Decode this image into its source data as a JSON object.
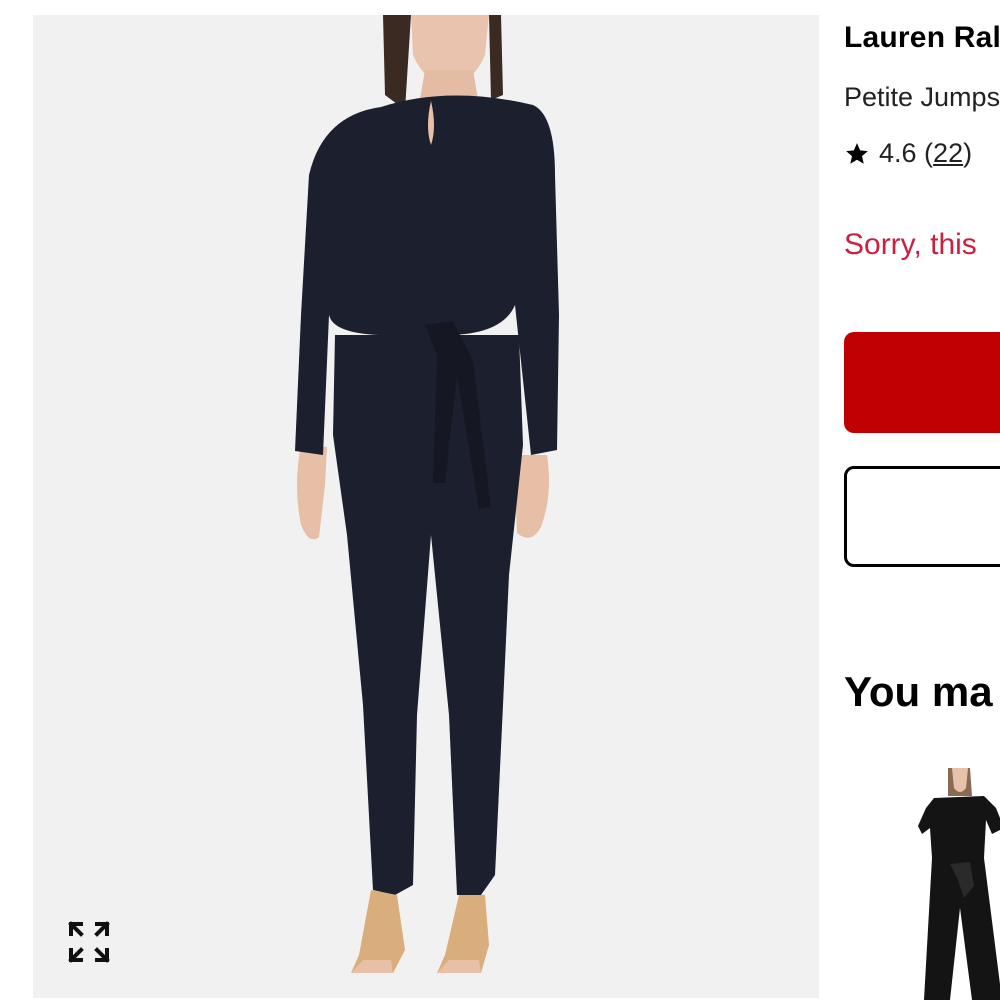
{
  "product": {
    "brand": "Lauren Ral",
    "name": "Petite Jumps",
    "rating": "4.6",
    "review_count": "22",
    "availability_message": "Sorry, this"
  },
  "recommendations": {
    "heading": "You ma"
  },
  "colors": {
    "accent_red": "#c00000",
    "alert_red": "#cc1f3f",
    "image_bg": "#f1f1f1",
    "garment_navy": "#1c1f2e"
  },
  "icons": {
    "expand": "expand-arrows-icon",
    "star": "star-icon"
  }
}
